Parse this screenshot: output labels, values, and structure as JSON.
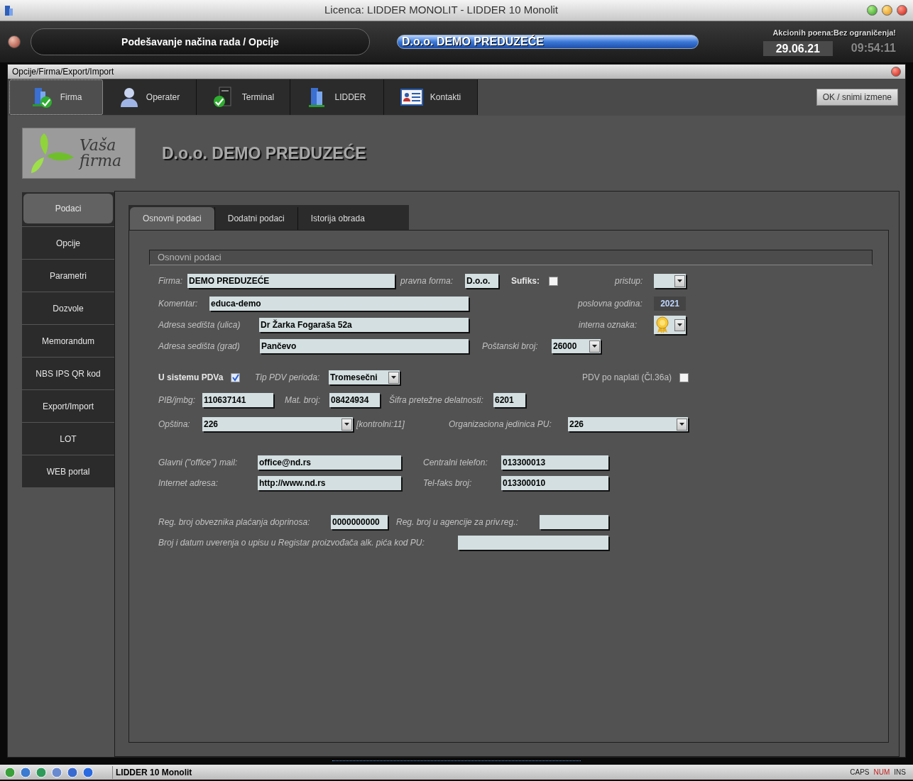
{
  "window": {
    "title": "Licenca: LIDDER MONOLIT - LIDDER 10 Monolit"
  },
  "header": {
    "mode_title": "Podešavanje načina rada / Opcije",
    "company_banner": "D.o.o. DEMO PREDUZEĆE",
    "points_label": "Akcionih poena:Bez ograničenja!",
    "date": "29.06.21",
    "time": "09:54:11"
  },
  "subwindow": {
    "title": "Opcije/Firma/Export/Import"
  },
  "toolbar": [
    {
      "label": "Firma",
      "kind": "building-check",
      "selected": true
    },
    {
      "label": "Operater",
      "kind": "person",
      "selected": false
    },
    {
      "label": "Terminal",
      "kind": "computer-check",
      "selected": false
    },
    {
      "label": "LIDDER",
      "kind": "building",
      "selected": false
    },
    {
      "label": "Kontakti",
      "kind": "contact-card",
      "selected": false
    }
  ],
  "ok_button": "OK / snimi izmene",
  "company": {
    "logo_text": [
      "Vaša",
      "firma"
    ],
    "name": "D.o.o. DEMO PREDUZEĆE"
  },
  "side_nav": [
    {
      "label": "Podaci",
      "selected": true
    },
    {
      "label": "Opcije",
      "selected": false
    },
    {
      "label": "Parametri",
      "selected": false
    },
    {
      "label": "Dozvole",
      "selected": false
    },
    {
      "label": "Memorandum",
      "selected": false
    },
    {
      "label": "NBS IPS QR kod",
      "selected": false
    },
    {
      "label": "Export/Import",
      "selected": false
    },
    {
      "label": "LOT",
      "selected": false
    },
    {
      "label": "WEB portal",
      "selected": false
    }
  ],
  "tabs": [
    {
      "label": "Osnovni podaci",
      "selected": true
    },
    {
      "label": "Dodatni podaci",
      "selected": false
    },
    {
      "label": "Istorija obrada",
      "selected": false
    }
  ],
  "section_title": "Osnovni podaci",
  "rows": [
    {
      "items": [
        {
          "kind": "text-field",
          "label": "Firma:",
          "value": "DEMO PREDUZEĆE"
        },
        {
          "kind": "text-field",
          "label": "pravna forma:",
          "value": "D.o.o."
        },
        {
          "kind": "checkbox",
          "label": "Sufiks:",
          "bold": true,
          "italic": false,
          "checked": false
        },
        {
          "kind": "dropdown",
          "label": "pristup:"
        }
      ]
    },
    {
      "items": [
        {
          "kind": "text-field",
          "label": "Komentar:",
          "value": "educa-demo"
        },
        {
          "kind": "readout",
          "label": "poslovna godina:",
          "value": "2021"
        }
      ]
    },
    {
      "items": [
        {
          "kind": "text-field",
          "label": "Adresa sedišta (ulica)",
          "value": "Dr Žarka Fogaraša 52a"
        },
        {
          "kind": "medal-dropdown",
          "label": "interna oznaka:"
        }
      ]
    },
    {
      "items": [
        {
          "kind": "text-field",
          "label": "Adresa sedišta (grad)",
          "value": "Pančevo"
        },
        {
          "kind": "dropdown",
          "label": "Poštanski broj:",
          "value": "26000"
        }
      ]
    },
    {
      "items": [
        {
          "kind": "checkbox",
          "label": "U sistemu PDVa",
          "bold": true,
          "italic": false,
          "checked": true
        },
        {
          "kind": "dropdown",
          "label": "Tip PDV perioda:",
          "value": "Tromesečni"
        },
        {
          "kind": "checkbox",
          "label": "PDV po naplati (Čl.36a)",
          "italic": false,
          "checked": false
        }
      ]
    },
    {
      "items": [
        {
          "kind": "text-field",
          "label": "PIB/jmbg:",
          "value": "110637141"
        },
        {
          "kind": "text-field",
          "label": "Mat. broj:",
          "value": "08424934"
        },
        {
          "kind": "text-field",
          "label": "Šifra pretežne delatnosti:",
          "value": "6201"
        }
      ]
    },
    {
      "items": [
        {
          "kind": "dropdown",
          "label": "Opština:",
          "value": "226"
        },
        {
          "kind": "note",
          "label": "[kontrolni:11]"
        },
        {
          "kind": "dropdown",
          "label": "Organizaciona jedinica PU:",
          "value": "226"
        }
      ]
    },
    {
      "items": [
        {
          "kind": "text-field",
          "label": "Glavni (\"office\") mail:",
          "value": "office@nd.rs"
        },
        {
          "kind": "text-field",
          "label": "Centralni telefon:",
          "value": "013300013"
        }
      ]
    },
    {
      "items": [
        {
          "kind": "text-field",
          "label": "Internet adresa:",
          "value": "http://www.nd.rs"
        },
        {
          "kind": "text-field",
          "label": "Tel-faks broj:",
          "value": "013300010"
        }
      ]
    },
    {
      "items": [
        {
          "kind": "text-field",
          "label": "Reg. broj obveznika plaćanja doprinosa:",
          "value": "0000000000"
        },
        {
          "kind": "text-field",
          "label": "Reg. broj u agencije za priv.reg.:"
        }
      ]
    },
    {
      "items": [
        {
          "kind": "text-field",
          "label": "Broj i datum uverenja o upisu u Registar proizvođača alk. pića kod PU:"
        }
      ]
    }
  ],
  "status_bar": {
    "app_name": "LIDDER 10 Monolit",
    "indicators": [
      {
        "label": "CAPS",
        "on": false
      },
      {
        "label": "NUM",
        "on": true
      },
      {
        "label": "INS",
        "on": false
      }
    ]
  }
}
